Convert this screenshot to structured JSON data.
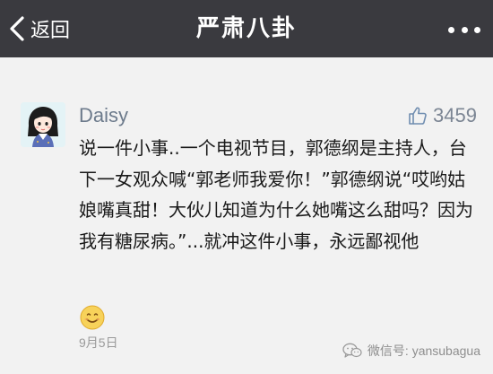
{
  "header": {
    "back_label": "返回",
    "title": "严肃八卦",
    "more_icon": "more-dots-icon",
    "background": "#3a3a3f"
  },
  "comment": {
    "author": "Daisy",
    "likes": "3459",
    "text": "说一件小事..一个电视节目，郭德纲是主持人，台下一女观众喊“郭老师我爱你！”郭德纲说“哎哟姑娘嘴真甜！大伙儿知道为什么她嘴这么甜吗？因为我有糖尿病。”...就冲这件小事，永远鄙视他",
    "emoji": "smiling-face-emoji",
    "date": "9月5日"
  },
  "watermark": {
    "text": "微信号: yansubagua",
    "icon": "wechat-icon"
  }
}
